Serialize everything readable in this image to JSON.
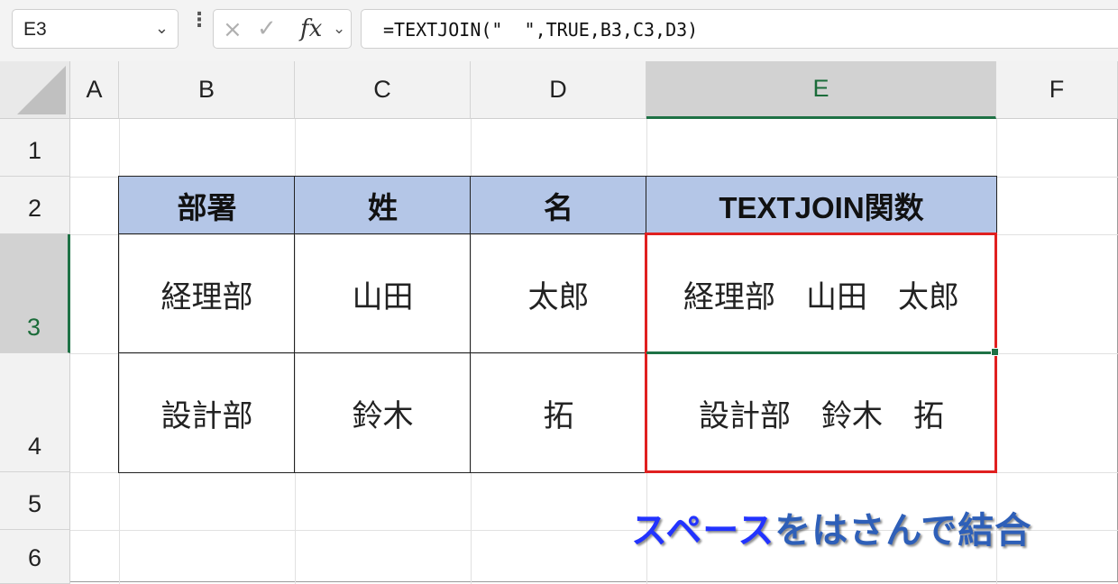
{
  "formula_bar": {
    "name_box": "E3",
    "cancel_icon": "×",
    "enter_icon": "✓",
    "fx_label": "fx",
    "formula": "=TEXTJOIN(\"  \",TRUE,B3,C3,D3)"
  },
  "columns": [
    "A",
    "B",
    "C",
    "D",
    "E",
    "F"
  ],
  "rows": [
    "1",
    "2",
    "3",
    "4",
    "5",
    "6"
  ],
  "selected_cell": "E3",
  "table": {
    "headers": [
      "部署",
      "姓",
      "名",
      "TEXTJOIN関数"
    ],
    "rows": [
      [
        "経理部",
        "山田",
        "太郎",
        "経理部　山田　太郎"
      ],
      [
        "設計部",
        "鈴木",
        "拓",
        "設計部　鈴木　拓"
      ]
    ]
  },
  "callout": {
    "part1": "スペース",
    "part2": "をはさんで結合"
  },
  "colors": {
    "header_fill": "#b4c6e7",
    "highlight_box": "#e02020",
    "selection": "#1e7145",
    "callout_blue": "#2233ff"
  }
}
